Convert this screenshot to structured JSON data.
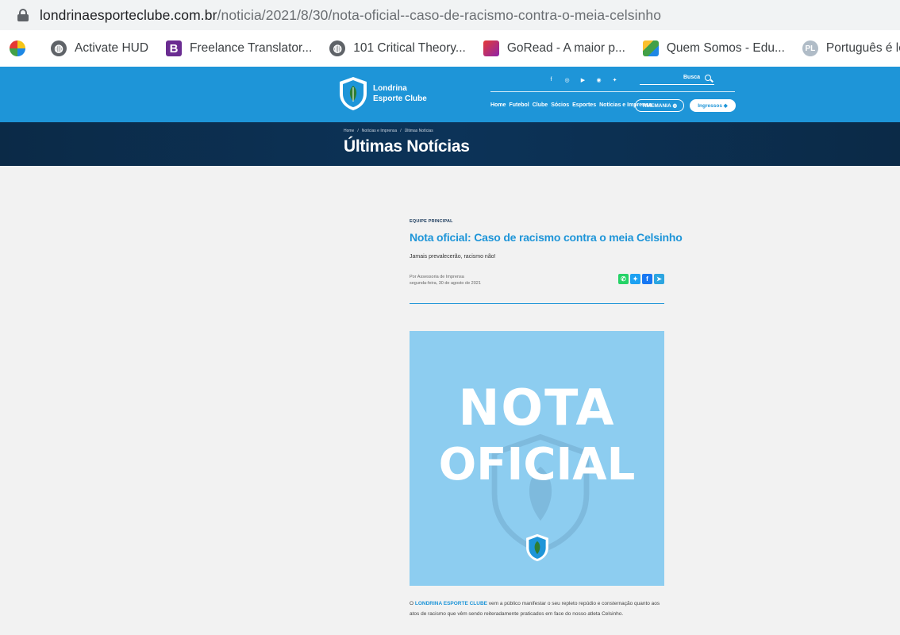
{
  "browser": {
    "url_domain": "londrinaesporteclube.com.br",
    "url_path": "/noticia/2021/8/30/nota-oficial--caso-de-racismo-contra-o-meia-celsinho",
    "bookmarks": [
      {
        "label": "",
        "icon": "app-favicon-icon"
      },
      {
        "label": "Activate HUD",
        "icon": "globe-icon"
      },
      {
        "label": "Freelance Translator...",
        "icon": "b-letter-icon"
      },
      {
        "label": "101 Critical Theory...",
        "icon": "globe-icon"
      },
      {
        "label": "GoRead - A maior p...",
        "icon": "goread-icon"
      },
      {
        "label": "Quem Somos - Edu...",
        "icon": "colorful-square-icon"
      },
      {
        "label": "Português é legal",
        "icon": "pl-badge-icon"
      }
    ]
  },
  "site": {
    "logo_line1": "Londrina",
    "logo_line2": "Esporte Clube",
    "socials": [
      "f",
      "◎",
      "▶",
      "◉",
      "✦"
    ],
    "search_label": "Busca",
    "nav": [
      "Home",
      "Futebol",
      "Clube",
      "Sócios",
      "Esportes",
      "Notícias e Imprensa"
    ],
    "pill_outline": "TIMEMANIA",
    "pill_solid": "Ingressos",
    "colors": {
      "primary": "#1e95d8",
      "banner": "#0c3358",
      "hero": "#8dcdf0"
    }
  },
  "banner": {
    "crumbs": [
      "Home",
      "/",
      "Notícias e Imprensa",
      "/",
      "Últimas Notícias"
    ],
    "title": "Últimas Notícias"
  },
  "article": {
    "category": "EQUIPE PRINCIPAL",
    "headline": "Nota oficial: Caso de racismo contra o meia Celsinho",
    "subtitle": "Jamais prevalecerão, racismo não!",
    "author": "Por Assessoria de Imprensa",
    "date": "segunda-feira, 30 de agosto de 2021",
    "hero_line1": "NOTA",
    "hero_line2": "OFICIAL",
    "body_prefix": "O ",
    "body_brand": "LONDRINA ESPORTE CLUBE",
    "body_rest": " vem a público manifestar o seu repleto repúdio e consternação quanto aos atos de racismo que vêm sendo reiteradamente praticados em face do nosso atleta Celsinho."
  }
}
